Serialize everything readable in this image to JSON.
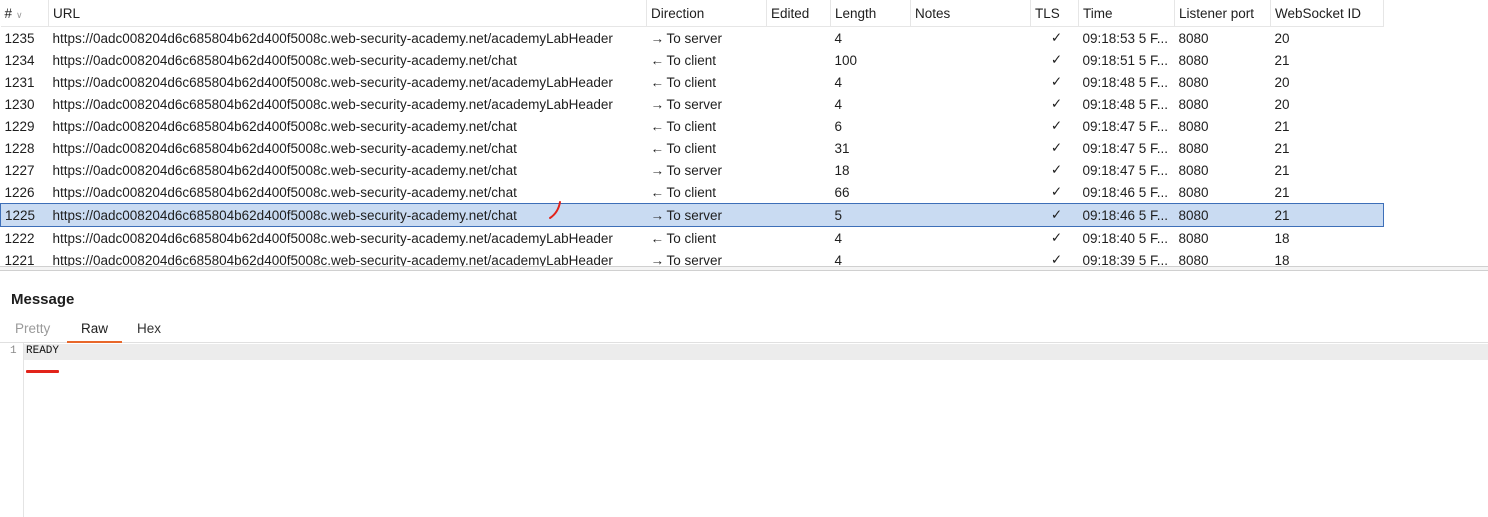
{
  "columns": [
    "#",
    "URL",
    "Direction",
    "Edited",
    "Length",
    "Notes",
    "TLS",
    "Time",
    "Listener port",
    "WebSocket ID"
  ],
  "rows": [
    {
      "id": "1235",
      "url": "https://0adc008204d6c685804b62d400f5008c.web-security-academy.net/academyLabHeader",
      "arrow": "→",
      "direction": "To server",
      "edited": "",
      "length": "4",
      "notes": "",
      "tls": "✓",
      "time": "09:18:53 5 F...",
      "port": "8080",
      "wsid": "20"
    },
    {
      "id": "1234",
      "url": "https://0adc008204d6c685804b62d400f5008c.web-security-academy.net/chat",
      "arrow": "←",
      "direction": "To client",
      "edited": "",
      "length": "100",
      "notes": "",
      "tls": "✓",
      "time": "09:18:51 5 F...",
      "port": "8080",
      "wsid": "21"
    },
    {
      "id": "1231",
      "url": "https://0adc008204d6c685804b62d400f5008c.web-security-academy.net/academyLabHeader",
      "arrow": "←",
      "direction": "To client",
      "edited": "",
      "length": "4",
      "notes": "",
      "tls": "✓",
      "time": "09:18:48 5 F...",
      "port": "8080",
      "wsid": "20"
    },
    {
      "id": "1230",
      "url": "https://0adc008204d6c685804b62d400f5008c.web-security-academy.net/academyLabHeader",
      "arrow": "→",
      "direction": "To server",
      "edited": "",
      "length": "4",
      "notes": "",
      "tls": "✓",
      "time": "09:18:48 5 F...",
      "port": "8080",
      "wsid": "20"
    },
    {
      "id": "1229",
      "url": "https://0adc008204d6c685804b62d400f5008c.web-security-academy.net/chat",
      "arrow": "←",
      "direction": "To client",
      "edited": "",
      "length": "6",
      "notes": "",
      "tls": "✓",
      "time": "09:18:47 5 F...",
      "port": "8080",
      "wsid": "21"
    },
    {
      "id": "1228",
      "url": "https://0adc008204d6c685804b62d400f5008c.web-security-academy.net/chat",
      "arrow": "←",
      "direction": "To client",
      "edited": "",
      "length": "31",
      "notes": "",
      "tls": "✓",
      "time": "09:18:47 5 F...",
      "port": "8080",
      "wsid": "21"
    },
    {
      "id": "1227",
      "url": "https://0adc008204d6c685804b62d400f5008c.web-security-academy.net/chat",
      "arrow": "→",
      "direction": "To server",
      "edited": "",
      "length": "18",
      "notes": "",
      "tls": "✓",
      "time": "09:18:47 5 F...",
      "port": "8080",
      "wsid": "21"
    },
    {
      "id": "1226",
      "url": "https://0adc008204d6c685804b62d400f5008c.web-security-academy.net/chat",
      "arrow": "←",
      "direction": "To client",
      "edited": "",
      "length": "66",
      "notes": "",
      "tls": "✓",
      "time": "09:18:46 5 F...",
      "port": "8080",
      "wsid": "21"
    },
    {
      "id": "1225",
      "url": "https://0adc008204d6c685804b62d400f5008c.web-security-academy.net/chat",
      "arrow": "→",
      "direction": "To server",
      "edited": "",
      "length": "5",
      "notes": "",
      "tls": "✓",
      "time": "09:18:46 5 F...",
      "port": "8080",
      "wsid": "21"
    },
    {
      "id": "1222",
      "url": "https://0adc008204d6c685804b62d400f5008c.web-security-academy.net/academyLabHeader",
      "arrow": "←",
      "direction": "To client",
      "edited": "",
      "length": "4",
      "notes": "",
      "tls": "✓",
      "time": "09:18:40 5 F...",
      "port": "8080",
      "wsid": "18"
    },
    {
      "id": "1221",
      "url": "https://0adc008204d6c685804b62d400f5008c.web-security-academy.net/academyLabHeader",
      "arrow": "→",
      "direction": "To server",
      "edited": "",
      "length": "4",
      "notes": "",
      "tls": "✓",
      "time": "09:18:39 5 F...",
      "port": "8080",
      "wsid": "18"
    }
  ],
  "selected_row": "1225",
  "message": {
    "title": "Message",
    "tabs": [
      "Pretty",
      "Raw",
      "Hex"
    ],
    "active_tab": "Raw",
    "line_number": "1",
    "content": "READY"
  },
  "colors": {
    "selection": "#c9dbf2",
    "selection_border": "#3d6fb8",
    "active_tab_underline": "#e8672a",
    "annotation": "#e2231a"
  }
}
